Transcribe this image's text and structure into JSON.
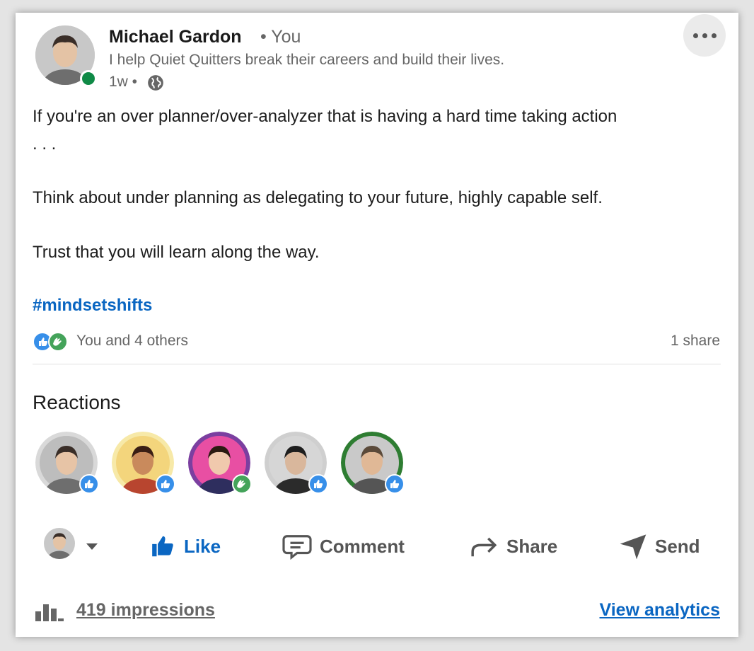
{
  "post": {
    "author_name": "Michael Gardon",
    "author_suffix": "• You",
    "headline": "I help Quiet Quitters break their careers and build their lives.",
    "time": "1w •",
    "body_line_1": "If you're an over planner/over-analyzer that is having a hard time taking action",
    "body_line_2": ". . .",
    "body_line_3": "Think about under planning as delegating to your future, highly capable self.",
    "body_line_4": "Trust that you will learn along the way.",
    "hashtag": "#mindsetshifts"
  },
  "social": {
    "reactions_summary": "You and 4 others",
    "shares": "1 share"
  },
  "reactions": {
    "title": "Reactions",
    "people": [
      {
        "reaction": "like-icon",
        "ring": "#d9d9d9",
        "skin": "#e7c4a6",
        "hair": "#3a2e28",
        "bg": "#bdbdbd",
        "shirt": "#6e6e6e"
      },
      {
        "reaction": "like-icon",
        "ring": "#f7e9a8",
        "skin": "#c98a5c",
        "hair": "#3a1e14",
        "bg": "#f3d57c",
        "shirt": "#b8452f"
      },
      {
        "reaction": "celebrate-icon",
        "ring": "#7b3fa0",
        "skin": "#f0c9ad",
        "hair": "#2b1b12",
        "bg": "#e84fa3",
        "shirt": "#2e2e5e"
      },
      {
        "reaction": "like-icon",
        "ring": "#cfcfcf",
        "skin": "#d9b79c",
        "hair": "#1e1e1e",
        "bg": "#d6d6d6",
        "shirt": "#2b2b2b"
      },
      {
        "reaction": "like-icon",
        "ring": "#2e7d32",
        "skin": "#e0b896",
        "hair": "#5b4a3a",
        "bg": "#c9c9c9",
        "shirt": "#555555"
      }
    ]
  },
  "actions": {
    "like": "Like",
    "comment": "Comment",
    "share": "Share",
    "send": "Send"
  },
  "footer": {
    "impressions": "419 impressions",
    "analytics": "View analytics"
  },
  "colors": {
    "brand_blue": "#0a66c2",
    "online_green": "#0f8a46",
    "muted_text": "#666666"
  }
}
